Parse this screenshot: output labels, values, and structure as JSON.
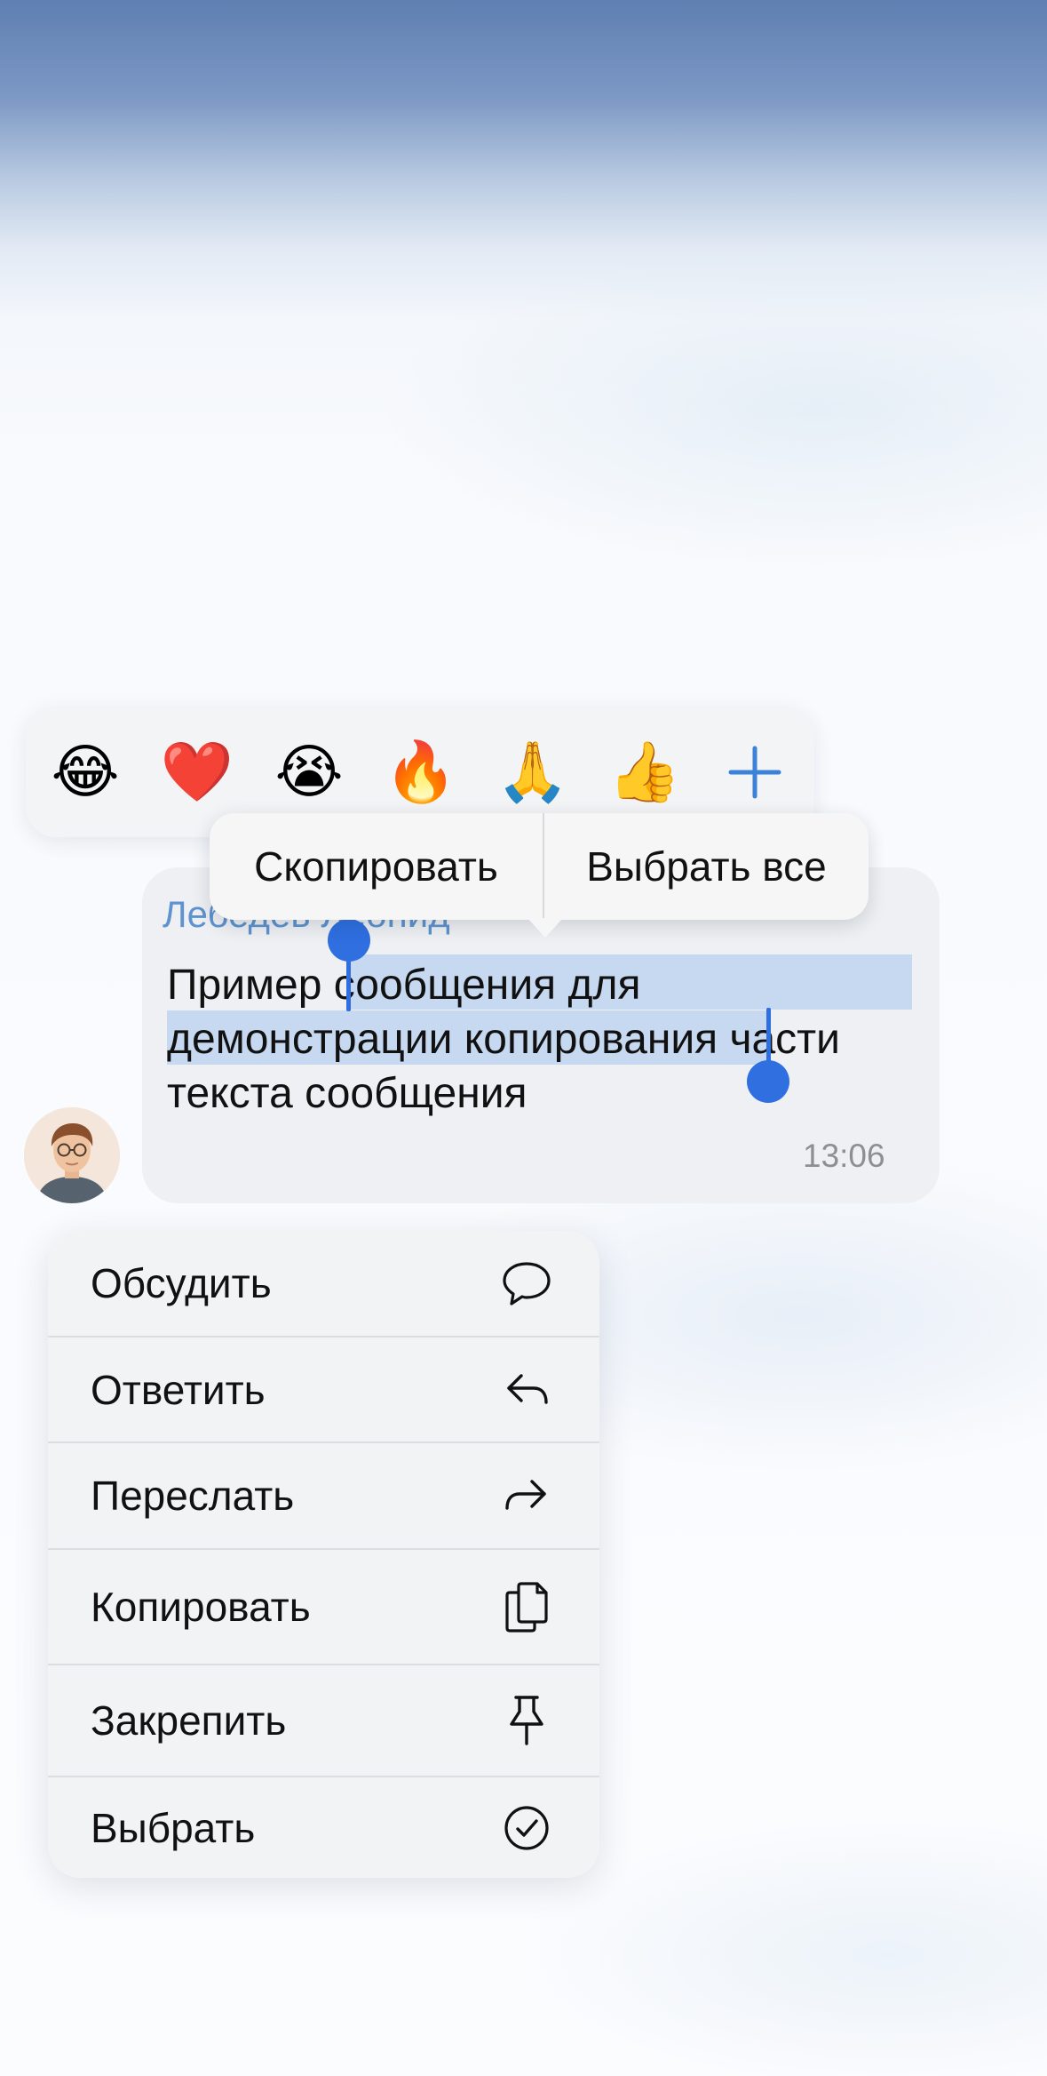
{
  "reactions": [
    {
      "emoji": "😂",
      "icon": "tears-of-joy-emoji"
    },
    {
      "emoji": "❤️",
      "icon": "red-heart-emoji"
    },
    {
      "emoji": "😭",
      "icon": "crying-face-emoji"
    },
    {
      "emoji": "🔥",
      "icon": "fire-emoji"
    },
    {
      "emoji": "🙏",
      "icon": "folded-hands-emoji"
    },
    {
      "emoji": "👍",
      "icon": "thumbs-up-emoji"
    }
  ],
  "reactions_more": "+",
  "popup": {
    "copy_label": "Скопировать",
    "select_all_label": "Выбрать все"
  },
  "message": {
    "sender": "Лебедев Леонид",
    "text_before": "Пример ",
    "text_selected": "сообщения для демонстрации копирования",
    "text_after": " части текста сообщения",
    "time": "13:06"
  },
  "menu": {
    "items": [
      {
        "label": "Обсудить",
        "icon": "speech-bubble-icon"
      },
      {
        "label": "Ответить",
        "icon": "reply-arrow-icon"
      },
      {
        "label": "Переслать",
        "icon": "forward-arrow-icon"
      },
      {
        "label": "Копировать",
        "icon": "copy-documents-icon"
      },
      {
        "label": "Закрепить",
        "icon": "pin-icon"
      },
      {
        "label": "Выбрать",
        "icon": "checkmark-circle-icon"
      }
    ]
  },
  "colors": {
    "accent": "#2f6fe0",
    "sender_name": "#5e93cf",
    "selection": "#c6d9f1"
  }
}
